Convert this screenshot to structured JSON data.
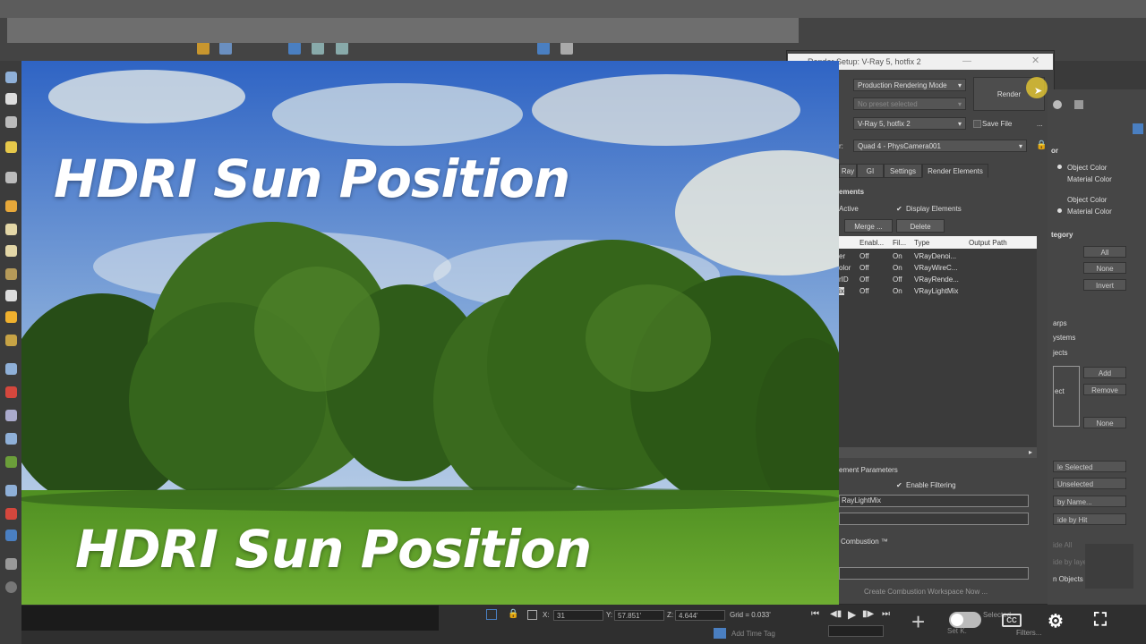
{
  "photo": {
    "title_top": "HDRI Sun Position",
    "title_bottom": "HDRI Sun Position"
  },
  "dialog": {
    "title": "Render Setup: V-Ray 5, hotfix 2",
    "target": "Production Rendering Mode",
    "preset": "No preset selected",
    "renderer": "V-Ray 5, hotfix 2",
    "save_file": "Save File",
    "view_label": "r:",
    "view": "Quad 4 - PhysCamera001",
    "render_button": "Render",
    "tabs": [
      "Ray",
      "GI",
      "Settings",
      "Render Elements"
    ],
    "section_elements": "ements",
    "active": "Active",
    "display_elements": "Display Elements",
    "merge": "Merge ...",
    "delete": "Delete",
    "columns": [
      "Enabl...",
      "Fil...",
      "Type",
      "Output Path"
    ],
    "rows": [
      {
        "name": "er",
        "enabled": "Off",
        "filter": "On",
        "type": "VRayDenoi..."
      },
      {
        "name": "olor",
        "enabled": "Off",
        "filter": "On",
        "type": "VRayWireC..."
      },
      {
        "name": "rID",
        "enabled": "Off",
        "filter": "Off",
        "type": "VRayRende..."
      },
      {
        "name": "ix",
        "enabled": "Off",
        "filter": "On",
        "type": "VRayLightMix"
      }
    ],
    "element_params": "ement Parameters",
    "enable_filtering": "Enable Filtering",
    "field_value": "RayLightMix",
    "combustion": "Combustion ™",
    "create_workspace": "Create Combustion Workspace Now ..."
  },
  "right_panel": {
    "color_header": "or",
    "object_color_1": "Object Color",
    "material_color_1": "Material Color",
    "object_color_2": "Object Color",
    "material_color_2": "Material Color",
    "category_header": "tegory",
    "all": "All",
    "none_1": "None",
    "invert": "Invert",
    "warps": "arps",
    "systems": "ystems",
    "objects": "jects",
    "ect": "ect",
    "add": "Add",
    "remove": "Remove",
    "none_2": "None",
    "hide_selected": "le Selected",
    "unselected": "Unselected",
    "by_name": "by Name...",
    "by_hit": "ide by Hit",
    "hide_all": "ide All",
    "by_layer": "ide by laye",
    "n_objects": "n Objects"
  },
  "status": {
    "x_label": "X:",
    "x_value": "31",
    "y_label": "Y:",
    "y_value": "57.851'",
    "z_label": "Z:",
    "z_value": "4.644'",
    "grid": "Grid = 0.033'",
    "add_time_tag": "Add Time Tag",
    "selected": "Selected",
    "filters": "Filters...",
    "set_k": "Set K."
  },
  "colors": {
    "accent": "#4a7fc1",
    "highlight": "#f2d230"
  }
}
